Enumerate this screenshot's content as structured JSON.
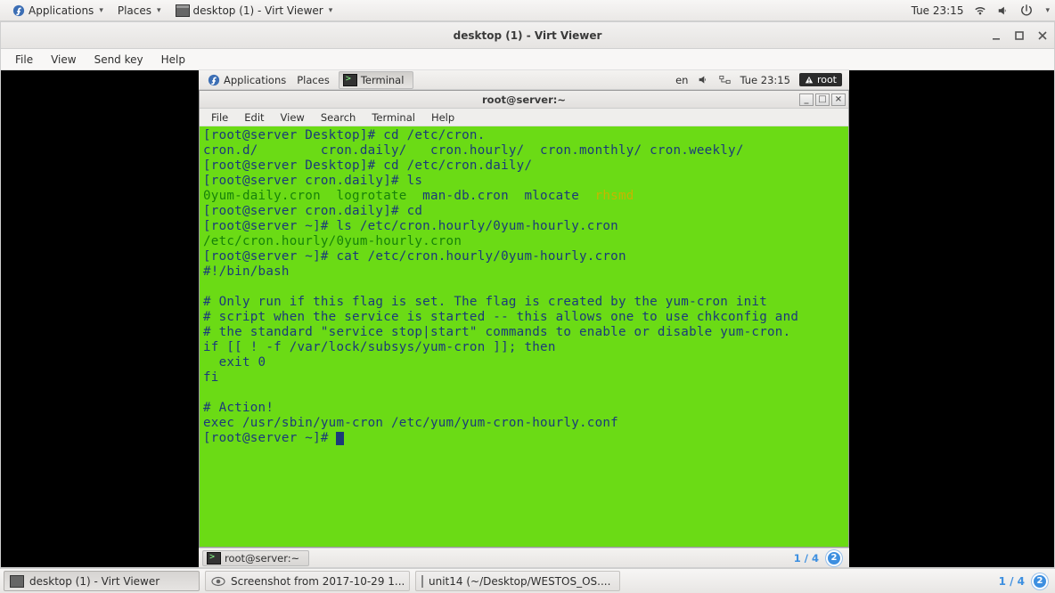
{
  "outer": {
    "topPanel": {
      "applications": "Applications",
      "places": "Places",
      "activeTask": "desktop (1) - Virt Viewer",
      "clock": "Tue 23:15"
    },
    "virtViewer": {
      "title": "desktop (1) - Virt Viewer",
      "menu": {
        "file": "File",
        "view": "View",
        "sendkey": "Send key",
        "help": "Help"
      }
    },
    "bottomTasks": {
      "t1": "desktop (1) - Virt Viewer",
      "t2": "Screenshot from 2017-10-29 1...",
      "t3": "unit14 (~/Desktop/WESTOS_OS....",
      "ws_label": "1 / 4",
      "ws_badge": "2"
    }
  },
  "inner": {
    "topPanel": {
      "applications": "Applications",
      "places": "Places",
      "activeTask": "Terminal",
      "lang": "en",
      "clock": "Tue 23:15",
      "user": "root"
    },
    "terminalWindow": {
      "title": "root@server:~",
      "menu": {
        "file": "File",
        "edit": "Edit",
        "view": "View",
        "search": "Search",
        "terminal": "Terminal",
        "help": "Help"
      }
    },
    "bottomPanel": {
      "task": "root@server:~",
      "ws_label": "1 / 4",
      "ws_badge": "2"
    },
    "termLines": {
      "l1": "[root@server Desktop]# cd /etc/cron.",
      "l2": "cron.d/        cron.daily/   cron.hourly/  cron.monthly/ cron.weekly/",
      "l3": "[root@server Desktop]# cd /etc/cron.daily/",
      "l4": "[root@server cron.daily]# ls",
      "l5a": "0yum-daily.cron",
      "l5b": "  ",
      "l5c": "logrotate",
      "l5d": "  man-db.cron  mlocate  ",
      "l5e": "rhsmd",
      "l6": "[root@server cron.daily]# cd",
      "l7": "[root@server ~]# ls /etc/cron.hourly/0yum-hourly.cron",
      "l8": "/etc/cron.hourly/0yum-hourly.cron",
      "l9": "[root@server ~]# cat /etc/cron.hourly/0yum-hourly.cron",
      "l10": "#!/bin/bash",
      "l11": "",
      "l12": "# Only run if this flag is set. The flag is created by the yum-cron init",
      "l13": "# script when the service is started -- this allows one to use chkconfig and",
      "l14": "# the standard \"service stop|start\" commands to enable or disable yum-cron.",
      "l15": "if [[ ! -f /var/lock/subsys/yum-cron ]]; then",
      "l16": "  exit 0",
      "l17": "fi",
      "l18": "",
      "l19": "# Action!",
      "l20": "exec /usr/sbin/yum-cron /etc/yum/yum-cron-hourly.conf",
      "l21": "[root@server ~]# "
    }
  }
}
